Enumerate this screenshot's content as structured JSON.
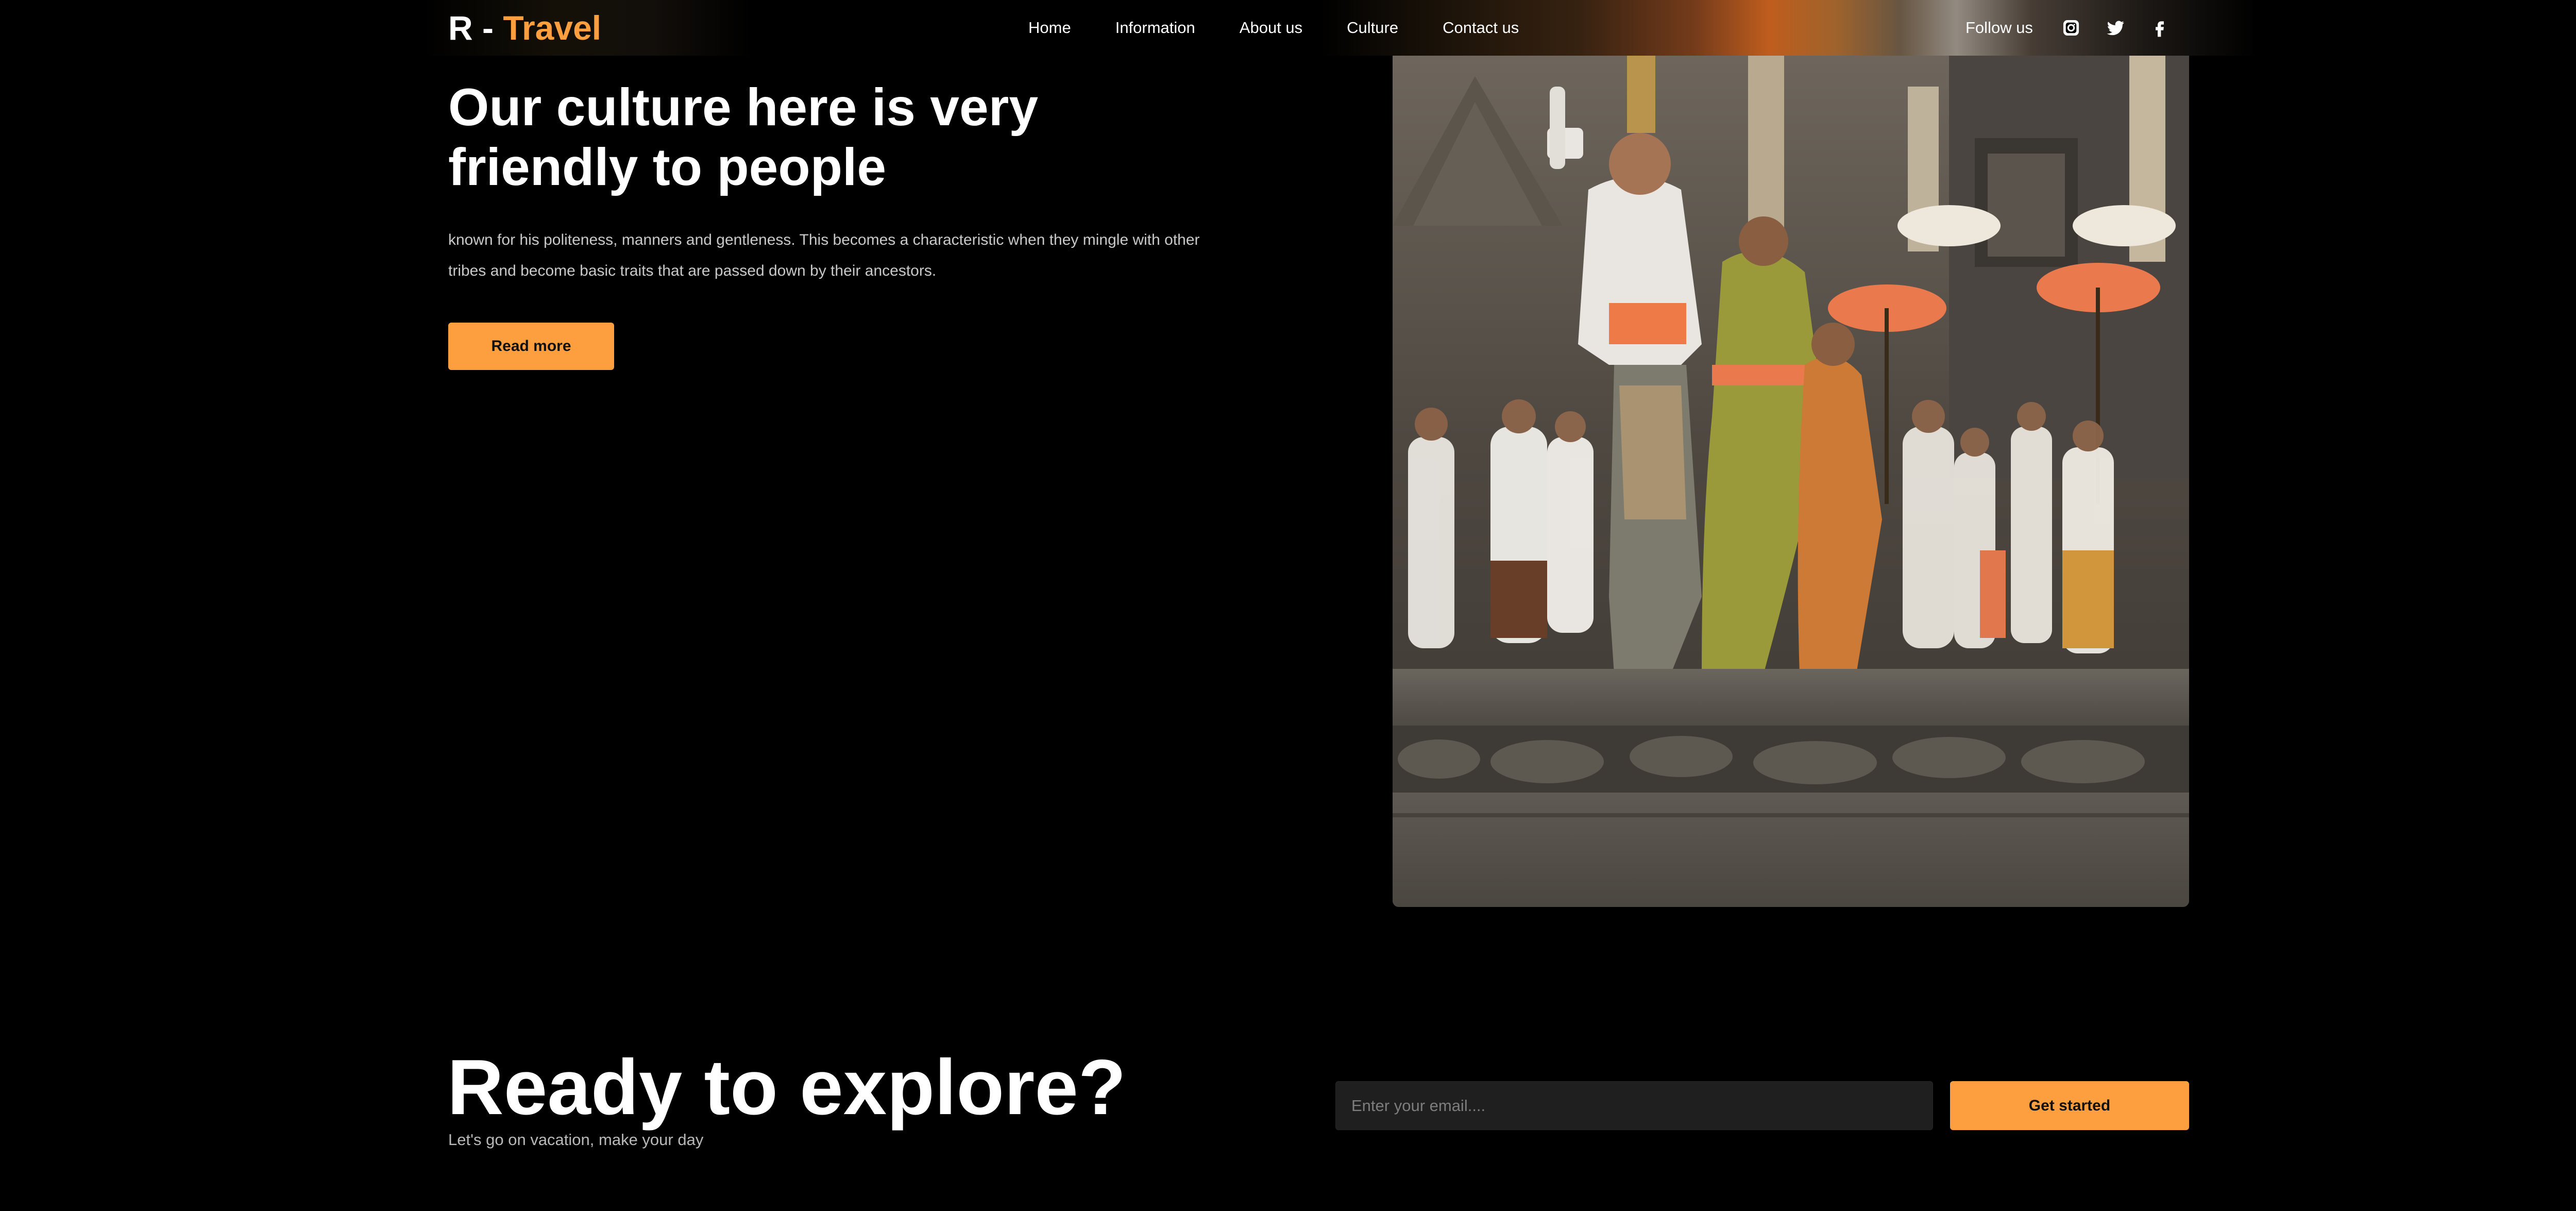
{
  "header": {
    "logo_main": "R - ",
    "logo_accent": "Travel",
    "nav": [
      {
        "label": "Home"
      },
      {
        "label": "Information"
      },
      {
        "label": "About us"
      },
      {
        "label": "Culture"
      },
      {
        "label": "Contact us"
      }
    ],
    "follow_label": "Follow us",
    "social": [
      "instagram-icon",
      "twitter-icon",
      "facebook-icon"
    ]
  },
  "hero": {
    "title": "Our culture here is very friendly to people",
    "description": "known for his politeness, manners and gentleness. This becomes a characteristic when they mingle with other tribes and become basic traits that are passed down by their ancestors.",
    "read_more_label": "Read more"
  },
  "cta": {
    "title": "Ready to explore?",
    "subtitle": "Let's go on vacation, make your day",
    "email_placeholder": "Enter your email....",
    "button_label": "Get started"
  },
  "colors": {
    "accent": "#fd9f3f",
    "background": "#000000",
    "input_bg": "#1f1f1f"
  }
}
